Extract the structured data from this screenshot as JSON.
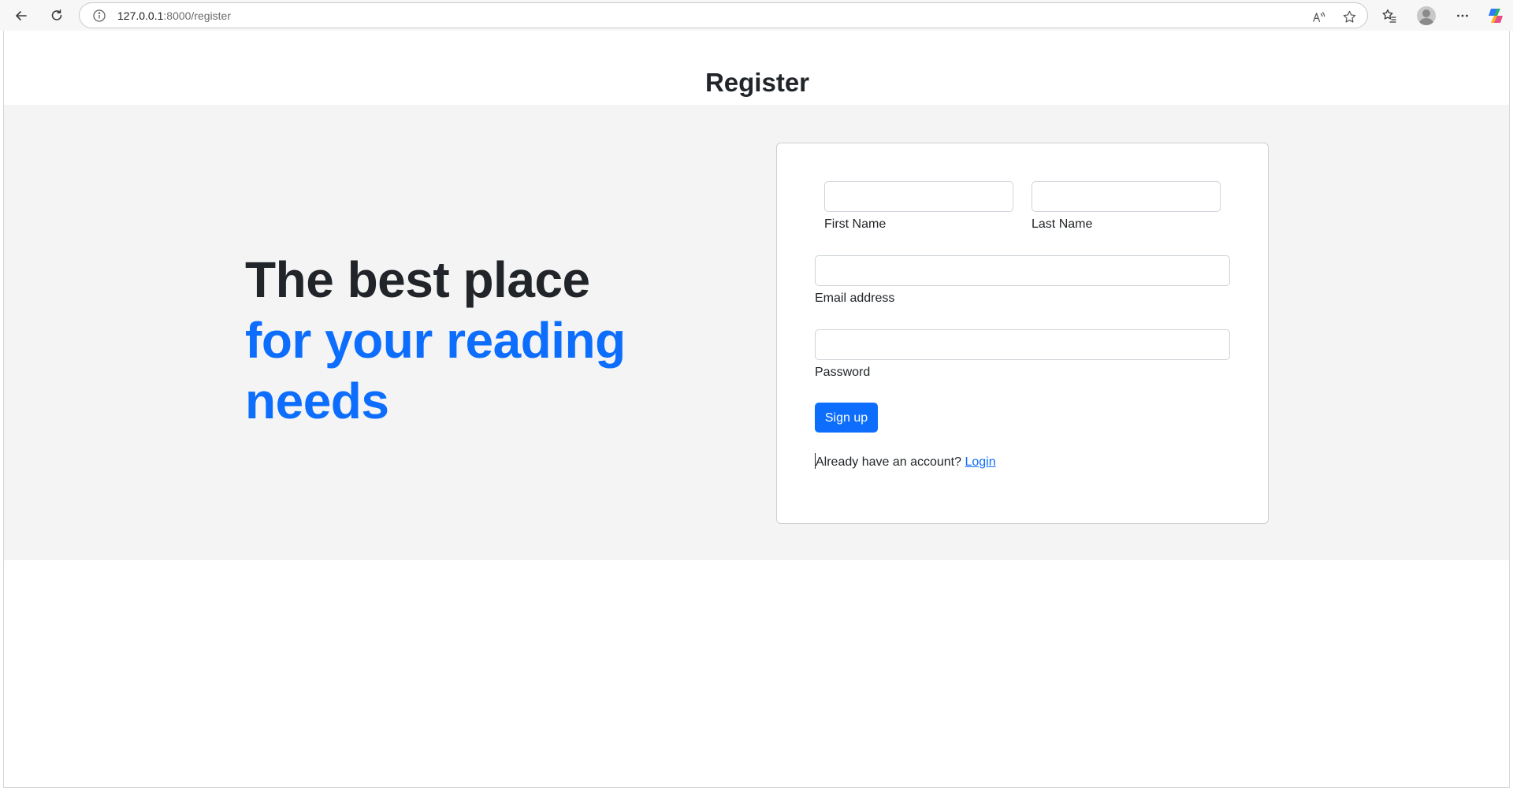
{
  "browser": {
    "url_host": "127.0.0.1",
    "url_path": ":8000/register"
  },
  "page": {
    "title": "Register"
  },
  "hero": {
    "line1": "The best place",
    "line2": "for your reading",
    "line3": "needs"
  },
  "form": {
    "first_name": {
      "label": "First Name",
      "value": ""
    },
    "last_name": {
      "label": "Last Name",
      "value": ""
    },
    "email": {
      "label": "Email address",
      "value": ""
    },
    "password": {
      "label": "Password",
      "value": ""
    },
    "submit_label": "Sign up",
    "account_prompt": "Already have an account?",
    "login_link": "Login"
  },
  "colors": {
    "accent": "#0d6efd",
    "hero_background": "#f4f4f4",
    "text": "#212529"
  }
}
